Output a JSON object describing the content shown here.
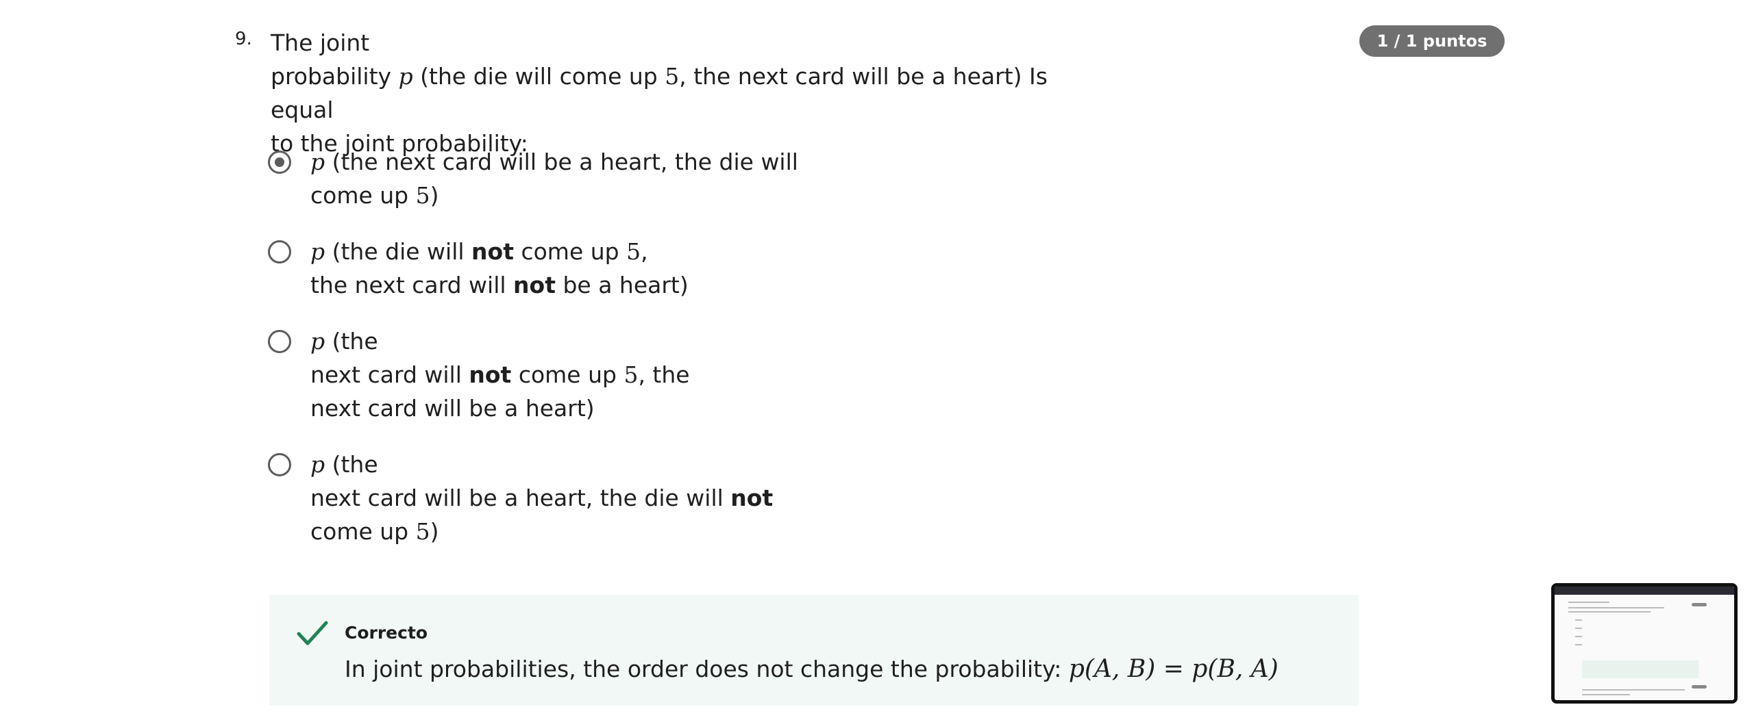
{
  "question": {
    "number": "9.",
    "intro": "The joint",
    "line2_a": "probability ",
    "p": "p",
    "line2_b": " (the die will come up ",
    "five": "5",
    "line2_c": ", the next card will be a heart) Is equal",
    "line3": "to the joint probability:",
    "score": "1 / 1 puntos"
  },
  "options": [
    {
      "selected": true,
      "l1_a": " (the next card will be a heart, the die will",
      "l2_a": "come up ",
      "l2_b": ")"
    },
    {
      "selected": false,
      "l1_a": " (the die will ",
      "l1_bold": "not",
      "l1_b": " come up ",
      "l1_c": ",",
      "l2_a": "the next card will ",
      "l2_bold": "not",
      "l2_b": " be a heart)"
    },
    {
      "selected": false,
      "l1_a": " (the",
      "l2_a": "next card will ",
      "l2_bold": "not",
      "l2_b": " come up ",
      "l2_c": ", the",
      "l3_a": "next card will be a heart)"
    },
    {
      "selected": false,
      "l1_a": " (the",
      "l2_a": "next card will be a heart, the die will ",
      "l2_bold": "not",
      "l3_a": "come up ",
      "l3_b": ")"
    }
  ],
  "feedback": {
    "title": "Correcto",
    "text": "In joint probabilities, the order does not change the probability: ",
    "formula": "p(A, B) = p(B, A)"
  },
  "icons": {
    "radio": "radio-icon",
    "check": "check-icon"
  },
  "colors": {
    "badge_bg": "#707070",
    "check": "#1f8354",
    "feedback_bg": "#f2f8f5"
  }
}
